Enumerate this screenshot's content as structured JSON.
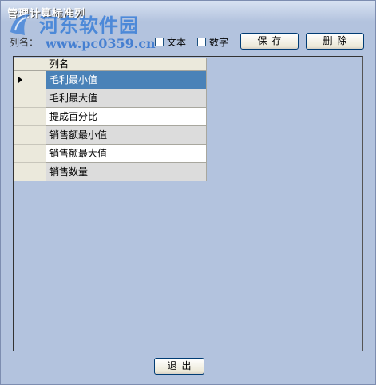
{
  "window": {
    "title": "管理计算标准列"
  },
  "watermark": {
    "name": "河东软件园",
    "url": "www.pc0359.cn"
  },
  "toolbar": {
    "colname_label": "列名：",
    "checkbox_text": {
      "label": "文本",
      "checked": false
    },
    "checkbox_number": {
      "label": "数字",
      "checked": false
    },
    "save_label": "保存",
    "delete_label": "删除"
  },
  "grid": {
    "header": "列名",
    "rows": [
      "毛利最小值",
      "毛利最大值",
      "提成百分比",
      "销售额最小值",
      "销售额最大值",
      "销售数量"
    ],
    "selected_index": 0
  },
  "footer": {
    "exit_label": "退出"
  },
  "colors": {
    "background": "#b3c3de",
    "selection": "#4a82b8",
    "row_alt": "#dcdcdc"
  }
}
